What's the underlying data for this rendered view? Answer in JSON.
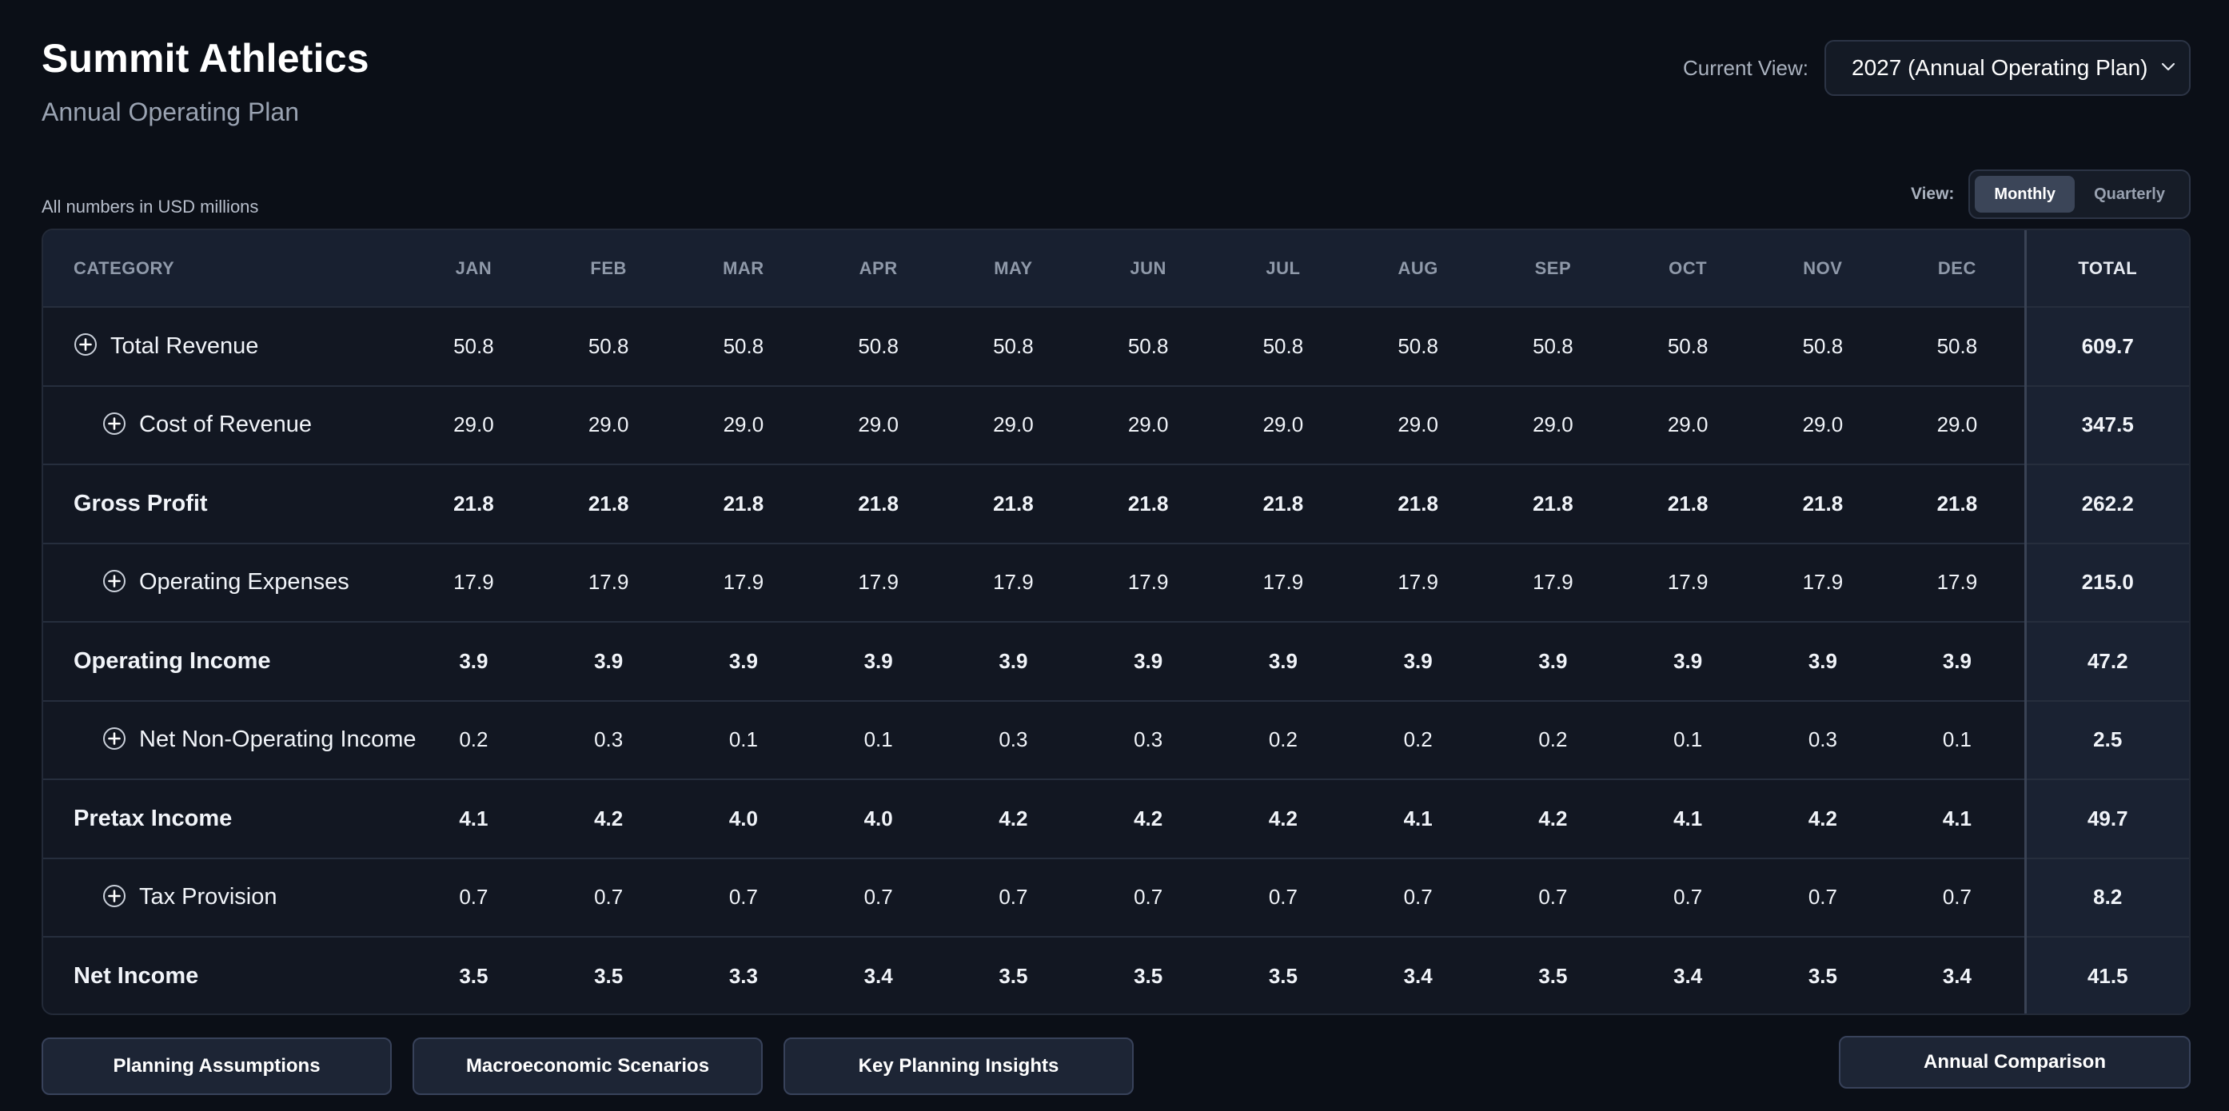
{
  "header": {
    "title": "Summit Athletics",
    "subtitle": "Annual Operating Plan"
  },
  "current_view": {
    "label": "Current View:",
    "selected": "2027 (Annual Operating Plan)"
  },
  "units_note": "All numbers in USD millions",
  "period_toggle": {
    "label": "View:",
    "options": [
      "Monthly",
      "Quarterly"
    ],
    "active": "Monthly"
  },
  "table": {
    "columns": [
      "CATEGORY",
      "JAN",
      "FEB",
      "MAR",
      "APR",
      "MAY",
      "JUN",
      "JUL",
      "AUG",
      "SEP",
      "OCT",
      "NOV",
      "DEC",
      "TOTAL"
    ],
    "rows": [
      {
        "label": "Total Revenue",
        "expandable": true,
        "bold": false,
        "indent": 0,
        "values": [
          "50.8",
          "50.8",
          "50.8",
          "50.8",
          "50.8",
          "50.8",
          "50.8",
          "50.8",
          "50.8",
          "50.8",
          "50.8",
          "50.8"
        ],
        "total": "609.7"
      },
      {
        "label": "Cost of Revenue",
        "expandable": true,
        "bold": false,
        "indent": 1,
        "values": [
          "29.0",
          "29.0",
          "29.0",
          "29.0",
          "29.0",
          "29.0",
          "29.0",
          "29.0",
          "29.0",
          "29.0",
          "29.0",
          "29.0"
        ],
        "total": "347.5"
      },
      {
        "label": "Gross Profit",
        "expandable": false,
        "bold": true,
        "indent": 0,
        "values": [
          "21.8",
          "21.8",
          "21.8",
          "21.8",
          "21.8",
          "21.8",
          "21.8",
          "21.8",
          "21.8",
          "21.8",
          "21.8",
          "21.8"
        ],
        "total": "262.2"
      },
      {
        "label": "Operating Expenses",
        "expandable": true,
        "bold": false,
        "indent": 1,
        "values": [
          "17.9",
          "17.9",
          "17.9",
          "17.9",
          "17.9",
          "17.9",
          "17.9",
          "17.9",
          "17.9",
          "17.9",
          "17.9",
          "17.9"
        ],
        "total": "215.0"
      },
      {
        "label": "Operating Income",
        "expandable": false,
        "bold": true,
        "indent": 0,
        "values": [
          "3.9",
          "3.9",
          "3.9",
          "3.9",
          "3.9",
          "3.9",
          "3.9",
          "3.9",
          "3.9",
          "3.9",
          "3.9",
          "3.9"
        ],
        "total": "47.2"
      },
      {
        "label": "Net Non-Operating Income",
        "expandable": true,
        "bold": false,
        "indent": 1,
        "values": [
          "0.2",
          "0.3",
          "0.1",
          "0.1",
          "0.3",
          "0.3",
          "0.2",
          "0.2",
          "0.2",
          "0.1",
          "0.3",
          "0.1"
        ],
        "total": "2.5"
      },
      {
        "label": "Pretax Income",
        "expandable": false,
        "bold": true,
        "indent": 0,
        "values": [
          "4.1",
          "4.2",
          "4.0",
          "4.0",
          "4.2",
          "4.2",
          "4.2",
          "4.1",
          "4.2",
          "4.1",
          "4.2",
          "4.1"
        ],
        "total": "49.7"
      },
      {
        "label": "Tax Provision",
        "expandable": true,
        "bold": false,
        "indent": 1,
        "values": [
          "0.7",
          "0.7",
          "0.7",
          "0.7",
          "0.7",
          "0.7",
          "0.7",
          "0.7",
          "0.7",
          "0.7",
          "0.7",
          "0.7"
        ],
        "total": "8.2"
      },
      {
        "label": "Net Income",
        "expandable": false,
        "bold": true,
        "indent": 0,
        "values": [
          "3.5",
          "3.5",
          "3.3",
          "3.4",
          "3.5",
          "3.5",
          "3.5",
          "3.4",
          "3.5",
          "3.4",
          "3.5",
          "3.4"
        ],
        "total": "41.5"
      }
    ]
  },
  "footer_buttons": {
    "planning_assumptions": "Planning Assumptions",
    "macro_scenarios": "Macroeconomic Scenarios",
    "key_insights": "Key Planning Insights",
    "annual_comparison": "Annual Comparison"
  },
  "colors": {
    "background": "#0b0f17",
    "card": "#121722",
    "header_row": "#182030",
    "total_column": "#1a2232",
    "active_toggle": "#3b4558",
    "muted_text": "#9aa3b2"
  },
  "icons": {
    "expand": "plus-circle-icon",
    "dropdown": "chevron-down-icon"
  }
}
